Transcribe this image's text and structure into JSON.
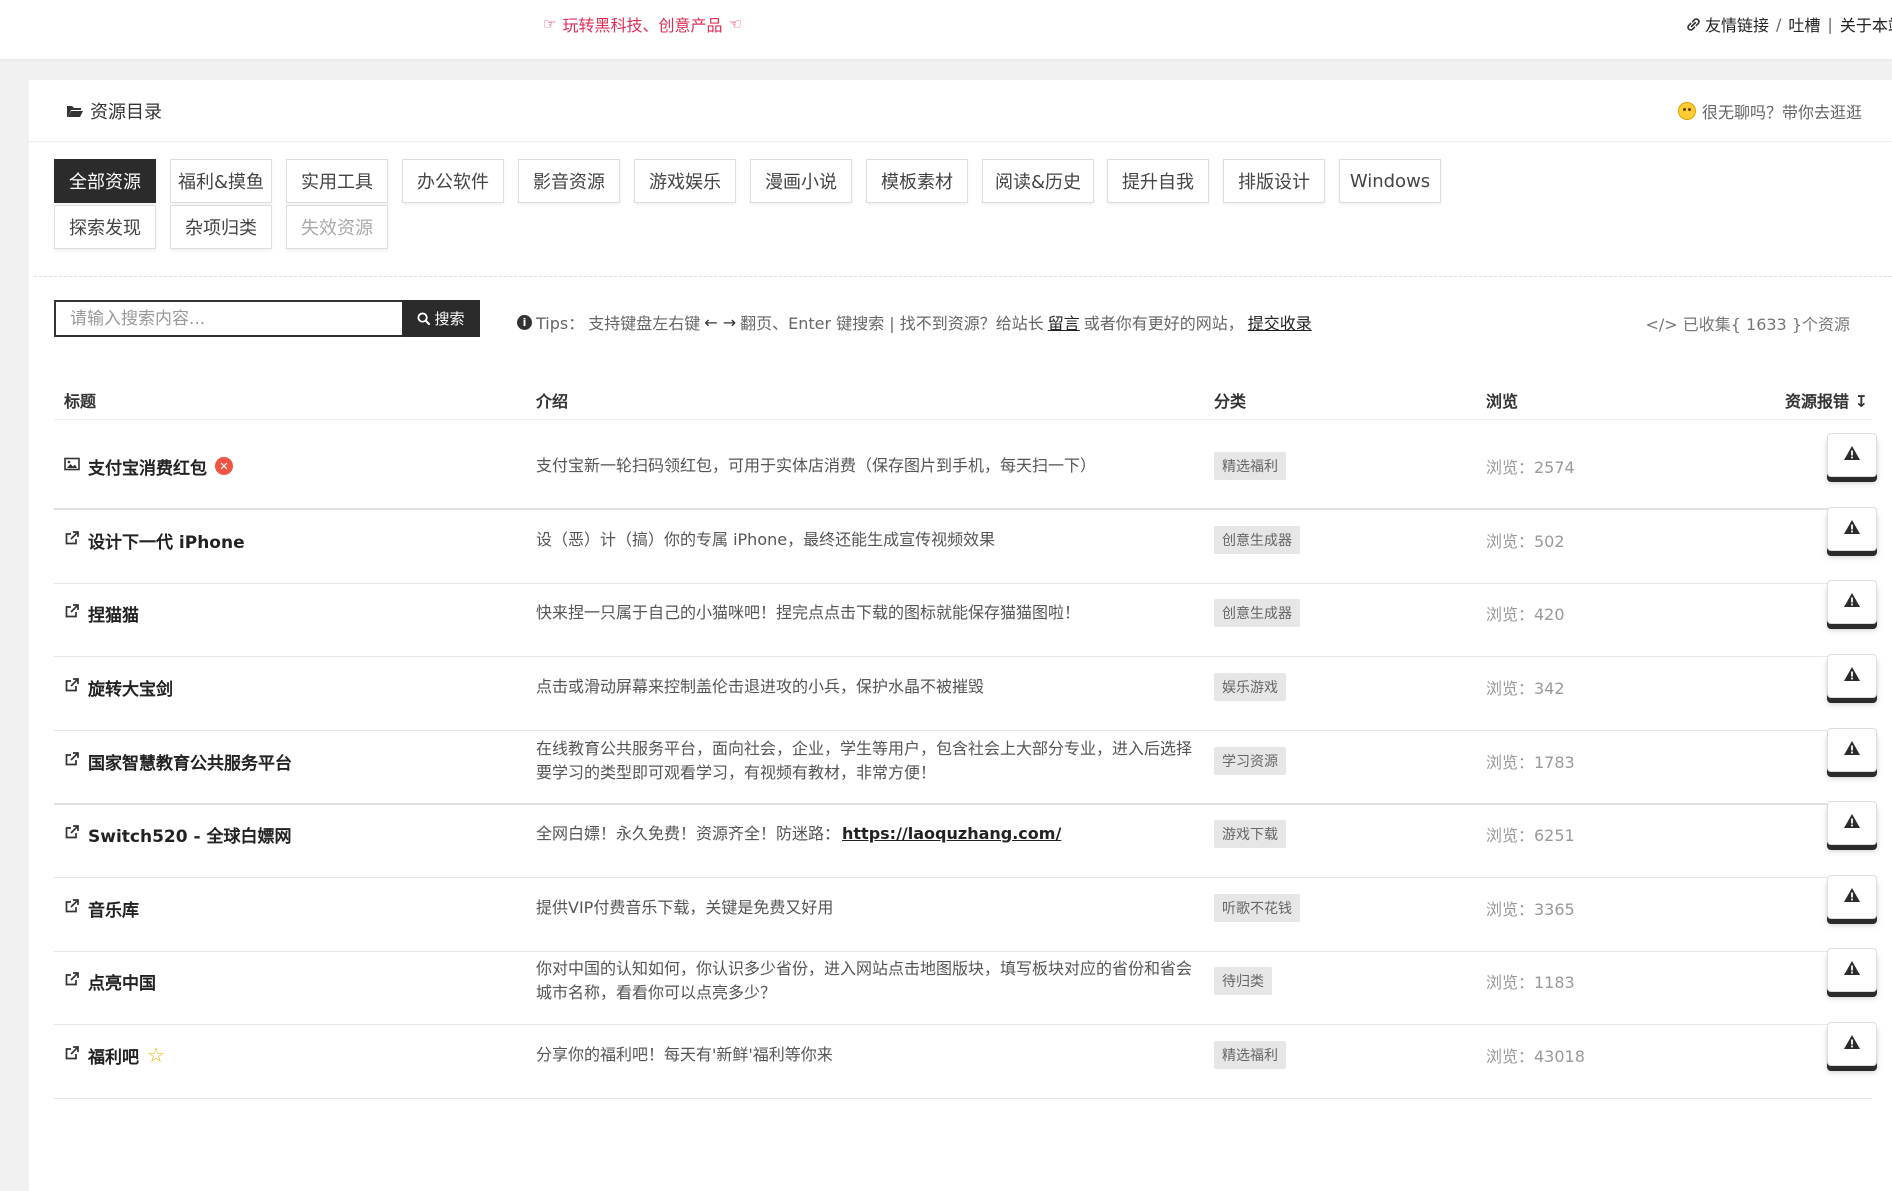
{
  "topbar": {
    "slogan": "玩转黑科技、创意产品",
    "links": [
      "友情链接",
      "吐槽",
      "关于本站"
    ],
    "link_seps": [
      "/",
      "|"
    ]
  },
  "panel": {
    "title": "资源目录",
    "bored_text": "很无聊吗？带你去逛逛"
  },
  "categories": [
    {
      "label": "全部资源",
      "active": true
    },
    {
      "label": "福利&摸鱼"
    },
    {
      "label": "实用工具"
    },
    {
      "label": "办公软件"
    },
    {
      "label": "影音资源"
    },
    {
      "label": "游戏娱乐"
    },
    {
      "label": "漫画小说"
    },
    {
      "label": "模板素材"
    },
    {
      "label": "阅读&历史"
    },
    {
      "label": "提升自我"
    },
    {
      "label": "排版设计"
    },
    {
      "label": "Windows"
    },
    {
      "label": "探索发现"
    },
    {
      "label": "杂项归类"
    },
    {
      "label": "失效资源",
      "dim": true
    }
  ],
  "search": {
    "placeholder": "请输入搜索内容...",
    "button": "搜索"
  },
  "tips": {
    "label": "Tips：",
    "text1": "支持键盘左右键",
    "arrows": "← →",
    "text2": "翻页、Enter 键搜索 | 找不到资源？给站长",
    "link1": "留言",
    "text3": "或者你有更好的网站，",
    "link2": "提交收录"
  },
  "collected": "</> 已收集{ 1633 }个资源",
  "table": {
    "headers": {
      "title": "标题",
      "intro": "介绍",
      "category": "分类",
      "views": "浏览",
      "report": "资源报错 ↧"
    },
    "rows": [
      {
        "title": "支付宝消费红包",
        "icon": "image-icon",
        "badge": "x",
        "desc": "支付宝新一轮扫码领红包，可用于实体店消费（保存图片到手机，每天扫一下）",
        "category": "精选福利",
        "views": "浏览：2574"
      },
      {
        "title": "设计下一代 iPhone",
        "icon": "external-link-icon",
        "desc": "设（恶）计（搞）你的专属 iPhone，最终还能生成宣传视频效果",
        "category": "创意生成器",
        "views": "浏览：502"
      },
      {
        "title": "捏猫猫",
        "icon": "external-link-icon",
        "desc": "快来捏一只属于自己的小猫咪吧！捏完点点击下载的图标就能保存猫猫图啦！",
        "category": "创意生成器",
        "views": "浏览：420"
      },
      {
        "title": "旋转大宝剑",
        "icon": "external-link-icon",
        "desc": "点击或滑动屏幕来控制盖伦击退进攻的小兵，保护水晶不被摧毁",
        "category": "娱乐游戏",
        "views": "浏览：342"
      },
      {
        "title": "国家智慧教育公共服务平台",
        "icon": "external-link-icon",
        "desc": "在线教育公共服务平台，面向社会，企业，学生等用户，包含社会上大部分专业，进入后选择要学习的类型即可观看学习，有视频有教材，非常方便！",
        "category": "学习资源",
        "views": "浏览：1783"
      },
      {
        "title": "Switch520 - 全球白嫖网",
        "icon": "external-link-icon",
        "desc": "全网白嫖！永久免费！资源齐全！防迷路：",
        "desc_link": "https://laoquzhang.com/",
        "category": "游戏下载",
        "views": "浏览：6251"
      },
      {
        "title": "音乐库",
        "icon": "external-link-icon",
        "desc": "提供VIP付费音乐下载，关键是免费又好用",
        "category": "听歌不花钱",
        "views": "浏览：3365"
      },
      {
        "title": "点亮中国",
        "icon": "external-link-icon",
        "desc": "你对中国的认知如何，你认识多少省份，进入网站点击地图版块，填写板块对应的省份和省会城市名称，看看你可以点亮多少？",
        "category": "待归类",
        "views": "浏览：1183"
      },
      {
        "title": "福利吧",
        "icon": "external-link-icon",
        "badge": "star",
        "desc": "分享你的福利吧！每天有'新鲜'福利等你来",
        "category": "精选福利",
        "views": "浏览：43018"
      }
    ]
  },
  "colors": {
    "accent": "#e02e56",
    "dark": "#2b2b2b",
    "tag_bg": "#e6e6e6"
  }
}
